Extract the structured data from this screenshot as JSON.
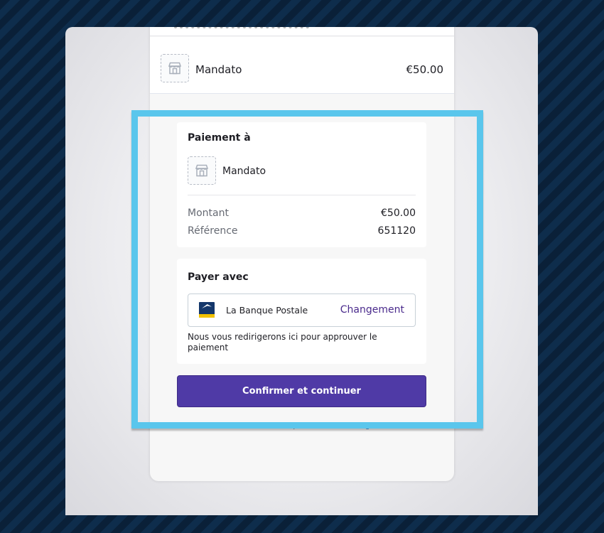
{
  "header": {
    "merchant_name": "Mandato",
    "amount": "€50.00"
  },
  "summary": {
    "heading": "Paiement à",
    "merchant_name": "Mandato",
    "rows": [
      {
        "label": "Montant",
        "value": "€50.00"
      },
      {
        "label": "Référence",
        "value": "651120"
      }
    ]
  },
  "payment": {
    "title": "Payer avec",
    "bank_name": "La Banque Postale",
    "change_label": "Changement",
    "note": "Nous vous redirigerons ici pour approuver le paiement"
  },
  "actions": {
    "confirm_label": "Confirmer et continuer"
  },
  "footer": {
    "terms_prefix": "En continuant, vous acceptez nos ",
    "terms_link": "Conditions générales"
  },
  "colors": {
    "primary_button": "#4f3aa6",
    "link": "#2a7ac9",
    "highlight_border": "#5ac6ec",
    "bank_logo": "#14376b"
  },
  "icons": {
    "merchant_logo": "store-placeholder-icon",
    "bank_logo": "la-banque-postale-logo-icon"
  }
}
